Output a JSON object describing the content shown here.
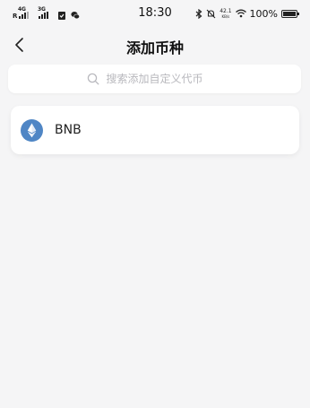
{
  "status_bar": {
    "signal_1_label": "4G",
    "signal_1_roaming": "R",
    "signal_2_label": "3G",
    "time": "18:30",
    "net_speed_value": "42.1",
    "net_speed_unit": "KB/s",
    "battery_percent": "100%",
    "battery_level": 1.0
  },
  "header": {
    "title": "添加币种"
  },
  "search": {
    "placeholder": "搜索添加自定义代币",
    "value": ""
  },
  "tokens": [
    {
      "name": "BNB",
      "icon": "ethereum-icon",
      "icon_color": "#4f86c5"
    }
  ],
  "colors": {
    "background": "#f5f5f6",
    "card": "#ffffff",
    "token_icon": "#4f86c5"
  }
}
